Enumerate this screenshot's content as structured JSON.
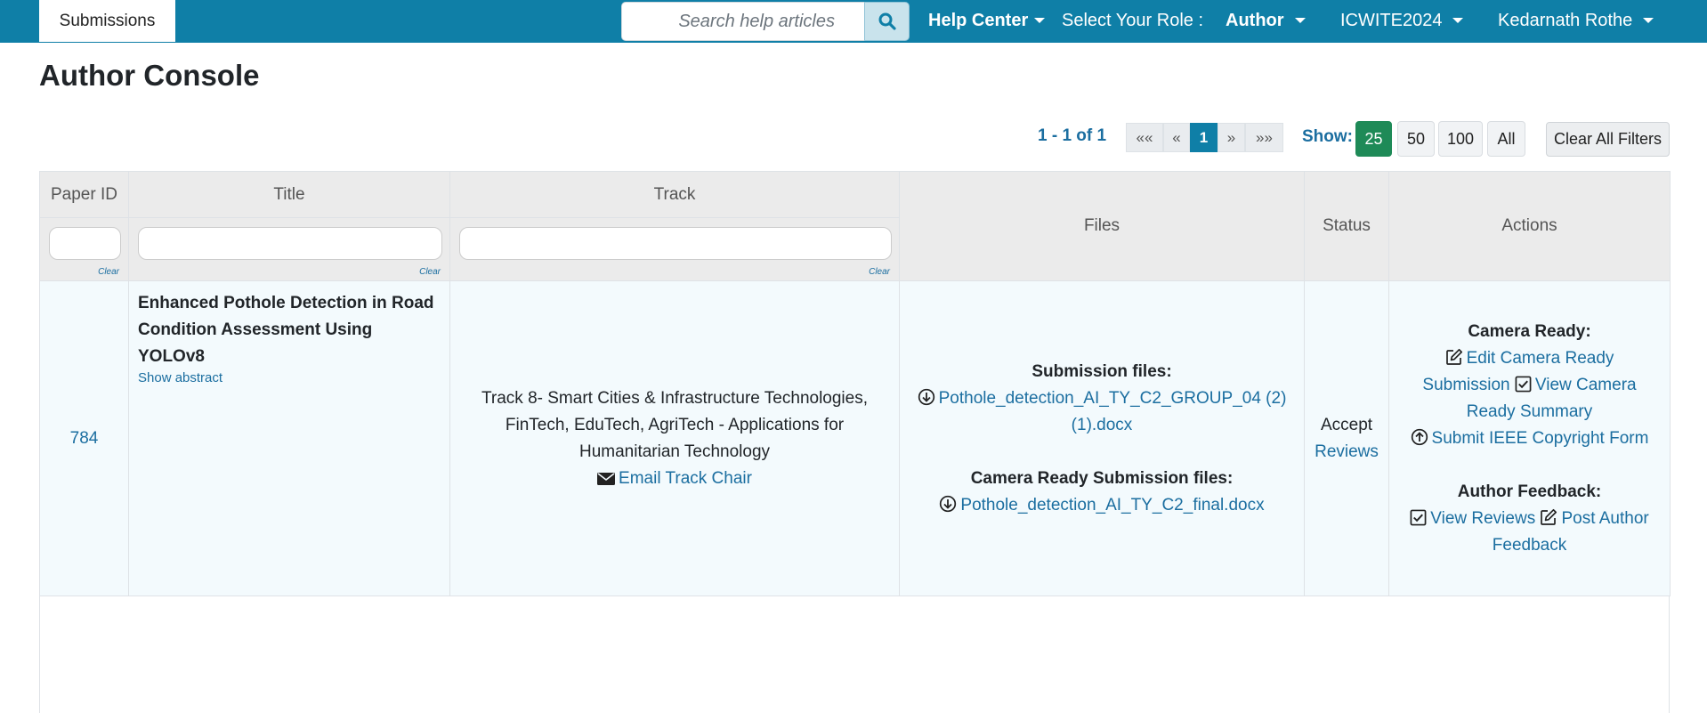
{
  "nav": {
    "tab_label": "Submissions",
    "search_placeholder": "Search help articles",
    "help_center": "Help Center",
    "role_label": "Select Your Role :",
    "role_value": "Author",
    "conference": "ICWITE2024",
    "user": "Kedarnath Rothe"
  },
  "page": {
    "title": "Author Console"
  },
  "pagination": {
    "count": "1 - 1 of 1",
    "first": "«« ",
    "prev": "«",
    "current": "1",
    "next": "»",
    "last": "»»",
    "show_label": "Show:",
    "sizes": [
      "25",
      "50",
      "100",
      "All"
    ],
    "clear_all": "Clear All Filters"
  },
  "table": {
    "headers": {
      "paper_id": "Paper ID",
      "title": "Title",
      "track": "Track",
      "files": "Files",
      "status": "Status",
      "actions": "Actions"
    },
    "filter_clear": "Clear",
    "row": {
      "paper_id": "784",
      "title": "Enhanced Pothole Detection in Road Condition Assessment Using YOLOv8",
      "show_abstract": "Show abstract",
      "track": "Track 8- Smart Cities & Infrastructure Technologies, FinTech, EduTech, AgriTech - Applications for Humanitarian Technology",
      "email_track_chair": "Email Track Chair",
      "submission_files_label": "Submission files:",
      "submission_file": "Pothole_detection_AI_TY_C2_GROUP_04 (2) (1).docx",
      "camera_files_label": "Camera Ready Submission files:",
      "camera_file": "Pothole_detection_AI_TY_C2_final.docx",
      "status": "Accept",
      "status_link": "Reviews",
      "camera_ready_label": "Camera Ready:",
      "edit_camera_ready": "Edit Camera Ready Submission",
      "view_camera_ready": "View Camera Ready Summary",
      "submit_copyright": "Submit IEEE Copyright Form",
      "author_feedback_label": "Author Feedback:",
      "view_reviews": "View Reviews",
      "post_feedback": "Post Author Feedback"
    }
  }
}
